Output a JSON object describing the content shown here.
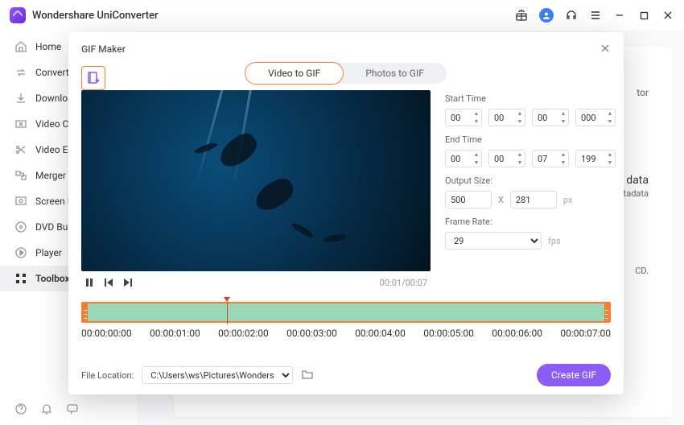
{
  "app": {
    "title": "Wondershare UniConverter"
  },
  "sidebar": {
    "items": [
      {
        "label": "Home"
      },
      {
        "label": "Converter"
      },
      {
        "label": "Downloader"
      },
      {
        "label": "Video Compressor"
      },
      {
        "label": "Video Editor"
      },
      {
        "label": "Merger"
      },
      {
        "label": "Screen Recorder"
      },
      {
        "label": "DVD Burner"
      },
      {
        "label": "Player"
      },
      {
        "label": "Toolbox"
      }
    ]
  },
  "bg": {
    "snip1": "tor",
    "snip2": "data",
    "snip3": "etadata",
    "snip4": "CD."
  },
  "modal": {
    "title": "GIF Maker",
    "tabs": {
      "video": "Video to GIF",
      "photos": "Photos to GIF"
    },
    "playback": {
      "current": "00:01",
      "total": "00:07",
      "combined": "00:01/00:07"
    },
    "settings": {
      "start_label": "Start Time",
      "start": {
        "h": "00",
        "m": "00",
        "s": "00",
        "ms": "000"
      },
      "end_label": "End Time",
      "end": {
        "h": "00",
        "m": "00",
        "s": "07",
        "ms": "199"
      },
      "size_label": "Output Size:",
      "size": {
        "w": "500",
        "h": "281",
        "x": "X",
        "unit": "px"
      },
      "rate_label": "Frame Rate:",
      "rate": {
        "value": "29",
        "unit": "fps"
      }
    },
    "ticks": [
      "00:00:00:00",
      "00:00:01:00",
      "00:00:02:00",
      "00:00:03:00",
      "00:00:04:00",
      "00:00:05:00",
      "00:00:06:00",
      "00:00:07:00"
    ],
    "footer": {
      "label": "File Location:",
      "path": "C:\\Users\\ws\\Pictures\\Wonders",
      "create": "Create GIF"
    }
  }
}
